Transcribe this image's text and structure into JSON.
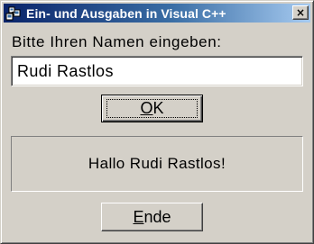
{
  "window": {
    "title": "Ein- und Ausgaben in Visual C++",
    "close_glyph": "×",
    "icon": "cpp-app-icon"
  },
  "form": {
    "prompt_label": "Bitte Ihren Namen eingeben:",
    "name_value": "Rudi Rastlos",
    "ok_mnemonic": "O",
    "ok_rest": "K",
    "output_text": "Hallo Rudi Rastlos!",
    "end_mnemonic": "E",
    "end_rest": "nde"
  },
  "colors": {
    "titlebar_start": "#0a246a",
    "titlebar_end": "#a6caf0",
    "face": "#d4d0c8"
  }
}
